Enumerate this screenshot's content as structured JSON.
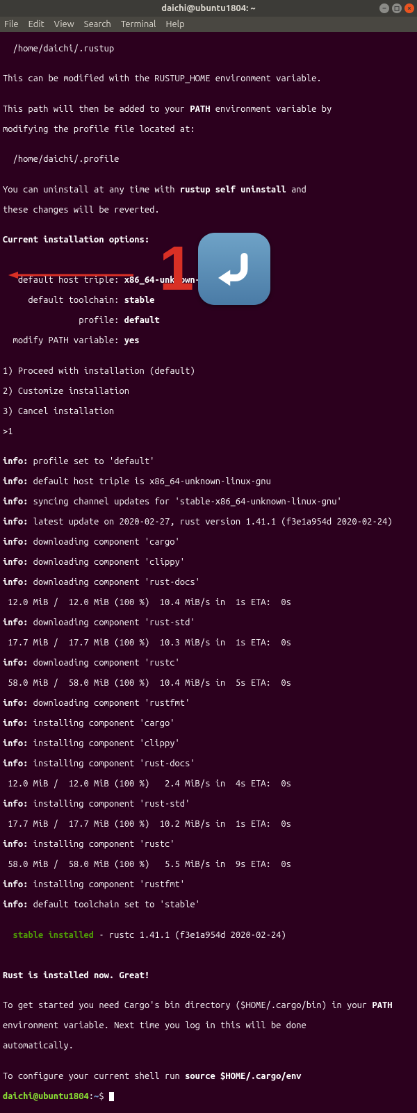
{
  "window": {
    "title": "daichi@ubuntu1804: ~"
  },
  "menu": [
    "File",
    "Edit",
    "View",
    "Search",
    "Terminal",
    "Help"
  ],
  "term": {
    "l0": "  /home/daichi/.rustup",
    "l1": "",
    "l2": "This can be modified with the RUSTUP_HOME environment variable.",
    "l3": "",
    "l4_a": "This path will then be added to your ",
    "l4_path": "PATH",
    "l4_b": " environment variable by",
    "l5": "modifying the profile file located at:",
    "l6": "",
    "l7": "  /home/daichi/.profile",
    "l8": "",
    "l9_a": "You can uninstall at any time with ",
    "l9_cmd": "rustup self uninstall",
    "l9_b": " and",
    "l10": "these changes will be reverted.",
    "l11": "",
    "l12": "Current installation options:",
    "l13": "",
    "l14": "",
    "opt1_l": "   default host triple: ",
    "opt1_v": "x86_64-unknown-linux-gnu",
    "opt2_l": "     default toolchain: ",
    "opt2_v": "stable",
    "opt3_l": "               profile: ",
    "opt3_v": "default",
    "opt4_l": "  modify PATH variable: ",
    "opt4_v": "yes",
    "blank": "",
    "m1": "1) Proceed with installation (default)",
    "m2": "2) Customize installation",
    "m3": "3) Cancel installation",
    "m4": ">1",
    "info": "info:",
    "i1": " profile set to 'default'",
    "i2": " default host triple is x86_64-unknown-linux-gnu",
    "i3": " syncing channel updates for 'stable-x86_64-unknown-linux-gnu'",
    "i4": " latest update on 2020-02-27, rust version 1.41.1 (f3e1a954d 2020-02-24)",
    "i5": " downloading component 'cargo'",
    "i6": " downloading component 'clippy'",
    "i7": " downloading component 'rust-docs'",
    "p1": " 12.0 MiB /  12.0 MiB (100 %)  10.4 MiB/s in  1s ETA:  0s",
    "i8": " downloading component 'rust-std'",
    "p2": " 17.7 MiB /  17.7 MiB (100 %)  10.3 MiB/s in  1s ETA:  0s",
    "i9": " downloading component 'rustc'",
    "p3": " 58.0 MiB /  58.0 MiB (100 %)  10.4 MiB/s in  5s ETA:  0s",
    "i10": " downloading component 'rustfmt'",
    "i11": " installing component 'cargo'",
    "i12": " installing component 'clippy'",
    "i13": " installing component 'rust-docs'",
    "p4": " 12.0 MiB /  12.0 MiB (100 %)   2.4 MiB/s in  4s ETA:  0s",
    "i14": " installing component 'rust-std'",
    "p5": " 17.7 MiB /  17.7 MiB (100 %)  10.2 MiB/s in  1s ETA:  0s",
    "i15": " installing component 'rustc'",
    "p6": " 58.0 MiB /  58.0 MiB (100 %)   5.5 MiB/s in  9s ETA:  0s",
    "i16": " installing component 'rustfmt'",
    "i17": " default toolchain set to 'stable'",
    "inst_a": "  stable installed",
    "inst_b": " - rustc 1.41.1 (f3e1a954d 2020-02-24)",
    "done": "Rust is installed now. Great!",
    "g1_a": "To get started you need Cargo's bin directory ($HOME/.cargo/bin) in your ",
    "g1_path": "PATH",
    "g2": "environment variable. Next time you log in this will be done",
    "g3": "automatically.",
    "cfg_a": "To configure your current shell run ",
    "cfg_b": "source $HOME/.cargo/env",
    "prompt_user": "daichi@ubuntu1804",
    "prompt_colon": ":",
    "prompt_path": "~",
    "prompt_dollar": "$ "
  },
  "overlay": {
    "digit": "1"
  }
}
